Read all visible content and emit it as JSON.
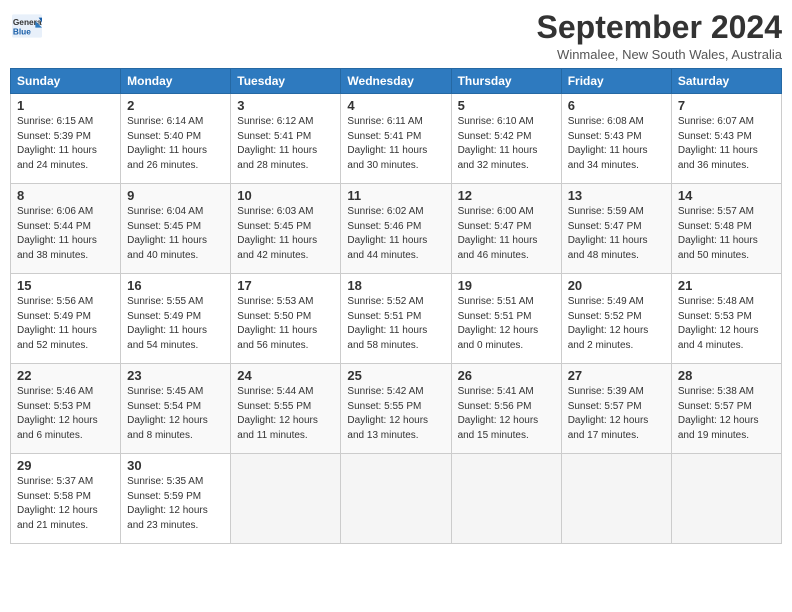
{
  "header": {
    "logo_line1": "General",
    "logo_line2": "Blue",
    "month_title": "September 2024",
    "subtitle": "Winmalee, New South Wales, Australia"
  },
  "days_of_week": [
    "Sunday",
    "Monday",
    "Tuesday",
    "Wednesday",
    "Thursday",
    "Friday",
    "Saturday"
  ],
  "weeks": [
    [
      {
        "day": "1",
        "info": "Sunrise: 6:15 AM\nSunset: 5:39 PM\nDaylight: 11 hours\nand 24 minutes."
      },
      {
        "day": "2",
        "info": "Sunrise: 6:14 AM\nSunset: 5:40 PM\nDaylight: 11 hours\nand 26 minutes."
      },
      {
        "day": "3",
        "info": "Sunrise: 6:12 AM\nSunset: 5:41 PM\nDaylight: 11 hours\nand 28 minutes."
      },
      {
        "day": "4",
        "info": "Sunrise: 6:11 AM\nSunset: 5:41 PM\nDaylight: 11 hours\nand 30 minutes."
      },
      {
        "day": "5",
        "info": "Sunrise: 6:10 AM\nSunset: 5:42 PM\nDaylight: 11 hours\nand 32 minutes."
      },
      {
        "day": "6",
        "info": "Sunrise: 6:08 AM\nSunset: 5:43 PM\nDaylight: 11 hours\nand 34 minutes."
      },
      {
        "day": "7",
        "info": "Sunrise: 6:07 AM\nSunset: 5:43 PM\nDaylight: 11 hours\nand 36 minutes."
      }
    ],
    [
      {
        "day": "8",
        "info": "Sunrise: 6:06 AM\nSunset: 5:44 PM\nDaylight: 11 hours\nand 38 minutes."
      },
      {
        "day": "9",
        "info": "Sunrise: 6:04 AM\nSunset: 5:45 PM\nDaylight: 11 hours\nand 40 minutes."
      },
      {
        "day": "10",
        "info": "Sunrise: 6:03 AM\nSunset: 5:45 PM\nDaylight: 11 hours\nand 42 minutes."
      },
      {
        "day": "11",
        "info": "Sunrise: 6:02 AM\nSunset: 5:46 PM\nDaylight: 11 hours\nand 44 minutes."
      },
      {
        "day": "12",
        "info": "Sunrise: 6:00 AM\nSunset: 5:47 PM\nDaylight: 11 hours\nand 46 minutes."
      },
      {
        "day": "13",
        "info": "Sunrise: 5:59 AM\nSunset: 5:47 PM\nDaylight: 11 hours\nand 48 minutes."
      },
      {
        "day": "14",
        "info": "Sunrise: 5:57 AM\nSunset: 5:48 PM\nDaylight: 11 hours\nand 50 minutes."
      }
    ],
    [
      {
        "day": "15",
        "info": "Sunrise: 5:56 AM\nSunset: 5:49 PM\nDaylight: 11 hours\nand 52 minutes."
      },
      {
        "day": "16",
        "info": "Sunrise: 5:55 AM\nSunset: 5:49 PM\nDaylight: 11 hours\nand 54 minutes."
      },
      {
        "day": "17",
        "info": "Sunrise: 5:53 AM\nSunset: 5:50 PM\nDaylight: 11 hours\nand 56 minutes."
      },
      {
        "day": "18",
        "info": "Sunrise: 5:52 AM\nSunset: 5:51 PM\nDaylight: 11 hours\nand 58 minutes."
      },
      {
        "day": "19",
        "info": "Sunrise: 5:51 AM\nSunset: 5:51 PM\nDaylight: 12 hours\nand 0 minutes."
      },
      {
        "day": "20",
        "info": "Sunrise: 5:49 AM\nSunset: 5:52 PM\nDaylight: 12 hours\nand 2 minutes."
      },
      {
        "day": "21",
        "info": "Sunrise: 5:48 AM\nSunset: 5:53 PM\nDaylight: 12 hours\nand 4 minutes."
      }
    ],
    [
      {
        "day": "22",
        "info": "Sunrise: 5:46 AM\nSunset: 5:53 PM\nDaylight: 12 hours\nand 6 minutes."
      },
      {
        "day": "23",
        "info": "Sunrise: 5:45 AM\nSunset: 5:54 PM\nDaylight: 12 hours\nand 8 minutes."
      },
      {
        "day": "24",
        "info": "Sunrise: 5:44 AM\nSunset: 5:55 PM\nDaylight: 12 hours\nand 11 minutes."
      },
      {
        "day": "25",
        "info": "Sunrise: 5:42 AM\nSunset: 5:55 PM\nDaylight: 12 hours\nand 13 minutes."
      },
      {
        "day": "26",
        "info": "Sunrise: 5:41 AM\nSunset: 5:56 PM\nDaylight: 12 hours\nand 15 minutes."
      },
      {
        "day": "27",
        "info": "Sunrise: 5:39 AM\nSunset: 5:57 PM\nDaylight: 12 hours\nand 17 minutes."
      },
      {
        "day": "28",
        "info": "Sunrise: 5:38 AM\nSunset: 5:57 PM\nDaylight: 12 hours\nand 19 minutes."
      }
    ],
    [
      {
        "day": "29",
        "info": "Sunrise: 5:37 AM\nSunset: 5:58 PM\nDaylight: 12 hours\nand 21 minutes."
      },
      {
        "day": "30",
        "info": "Sunrise: 5:35 AM\nSunset: 5:59 PM\nDaylight: 12 hours\nand 23 minutes."
      },
      {
        "day": "",
        "info": ""
      },
      {
        "day": "",
        "info": ""
      },
      {
        "day": "",
        "info": ""
      },
      {
        "day": "",
        "info": ""
      },
      {
        "day": "",
        "info": ""
      }
    ]
  ]
}
